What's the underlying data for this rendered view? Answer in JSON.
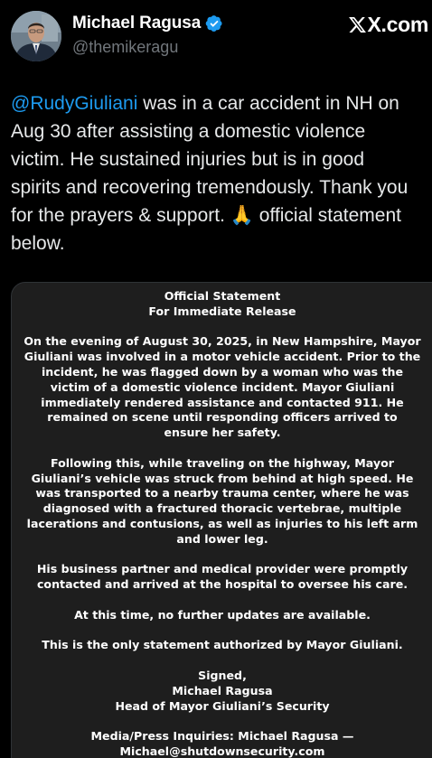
{
  "header": {
    "display_name": "Michael Ragusa",
    "handle": "@themikeragu",
    "verified": true,
    "brand": "X.com",
    "avatar_icon": "person-avatar-icon",
    "verified_icon": "verified-badge-icon",
    "brand_icon": "x-logo-icon"
  },
  "tweet": {
    "mention": "@RudyGiuliani",
    "line1_rest": " was in a car accident in NH on",
    "line2": "Aug 30 after assisting a domestic violence",
    "line3": "victim. He sustained injuries but is in good",
    "line4": "spirits and recovering tremendously. Thank you",
    "line5": "for the prayers & support. 🙏 official statement",
    "line6": "below."
  },
  "statement": {
    "title": "Official Statement",
    "subtitle": "For Immediate Release",
    "p1": [
      "On the evening of August 30, 2025, in New Hampshire, Mayor",
      "Giuliani was involved in a motor vehicle accident. Prior to the",
      "incident, he was flagged down by a woman who was the",
      "victim of a domestic violence incident. Mayor Giuliani",
      "immediately rendered assistance and contacted 911. He",
      "remained on scene until responding officers arrived to",
      "ensure her safety."
    ],
    "p2": [
      "Following this, while traveling on the highway, Mayor",
      "Giuliani’s vehicle was struck from behind at high speed. He",
      "was transported to a nearby trauma center, where he was",
      "diagnosed with a fractured thoracic vertebrae, multiple",
      "lacerations and contusions, as well as injuries to his left arm",
      "and lower leg."
    ],
    "p3": [
      "His business partner and medical provider were promptly",
      "contacted and arrived at the hospital to oversee his care."
    ],
    "p4": "At this time, no further updates are available.",
    "p5": "This is the only statement authorized by Mayor Giuliani.",
    "signed": "Signed,",
    "signer_name": "Michael Ragusa",
    "signer_title": "Head of Mayor Giuliani’s Security",
    "media_line1": "Media/Press Inquiries: Michael Ragusa —",
    "media_line2": "Michael@shutdownsecurity.com"
  },
  "colors": {
    "background": "#000000",
    "text": "#e7e9ea",
    "secondary": "#71767b",
    "link": "#1d9bf0",
    "verified": "#1d9bf0",
    "media_bg": "#1e1e1e"
  }
}
